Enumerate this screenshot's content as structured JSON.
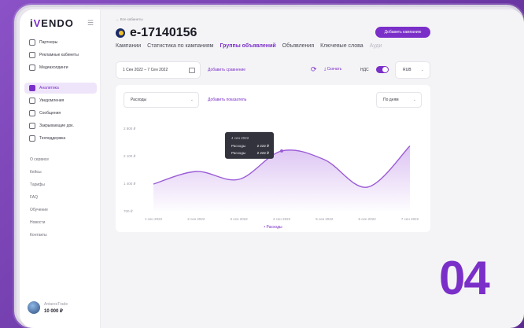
{
  "brand": {
    "logo_prefix": "i",
    "logo_v": "V",
    "logo_rest": "ENDO"
  },
  "sidebar": {
    "items": [
      {
        "label": "Партнеры",
        "icon": "handshake-icon"
      },
      {
        "label": "Рекламные кабинеты",
        "icon": "cabinet-icon"
      },
      {
        "label": "Медиахолдинги",
        "icon": "media-icon"
      },
      {
        "label": "Аналитика",
        "icon": "analytics-icon",
        "active": true
      },
      {
        "label": "Уведомления",
        "icon": "bell-icon"
      },
      {
        "label": "Сообщения",
        "icon": "message-icon"
      },
      {
        "label": "Закрывающие док.",
        "icon": "document-icon"
      },
      {
        "label": "Техподдержка",
        "icon": "support-icon"
      }
    ],
    "links": [
      "О сервисе",
      "Кейсы",
      "Тарифы",
      "FAQ",
      "Обучение",
      "Новости",
      "Контакты"
    ],
    "user": {
      "name": "AntaresTrade",
      "balance": "10 000 ₽"
    }
  },
  "header": {
    "breadcrumb": "← Все кабинеты",
    "title": "e-17140156",
    "add_campaign": "Добавить кампанию",
    "tabs": [
      "Кампании",
      "Статистика по кампаниям",
      "Группы объявлений",
      "Объявления",
      "Ключевые слова",
      "Ауди"
    ]
  },
  "toolbar": {
    "date_range": "1 Сен 2022 – 7 Сен 2022",
    "add_compare": "Добавить сравнение",
    "download": "Скачать",
    "vat": "НДС",
    "currency": "RUB"
  },
  "chart_card": {
    "metric": "Расходы",
    "add_metric": "Добавить показатель",
    "period": "По дням"
  },
  "chart_data": {
    "type": "area",
    "x": [
      "1 сен 2022",
      "2 сен 2022",
      "3 сен 2022",
      "4 сен 2022",
      "5 сен 2022",
      "6 сен 2022",
      "7 сен 2022"
    ],
    "yticks": [
      "2 800 ₽",
      "2 100 ₽",
      "1 400 ₽",
      "700 ₽"
    ],
    "ylim": [
      700,
      2800
    ],
    "series": [
      {
        "name": "Расходы",
        "values": [
          1380,
          1700,
          1500,
          2222,
          2000,
          1300,
          2350
        ]
      }
    ],
    "tooltip": {
      "date": "4 сен 2022",
      "rows": [
        {
          "label": "Расходы",
          "value": "2 222 ₽"
        },
        {
          "label": "Расходы",
          "value": "2 222 ₽"
        }
      ]
    },
    "legend": "• Расходы",
    "color": "#9b5bd6"
  },
  "badge": "04"
}
